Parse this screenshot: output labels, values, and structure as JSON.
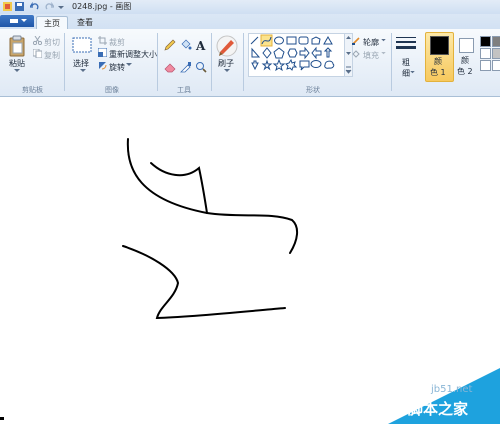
{
  "window": {
    "title": "0248.jpg - 画图"
  },
  "tabs": [
    {
      "label": "主页",
      "active": true
    },
    {
      "label": "查看",
      "active": false
    }
  ],
  "clipboard": {
    "paste_label": "粘贴",
    "cut_label": "剪切",
    "copy_label": "复制",
    "group_label": "剪贴板"
  },
  "image": {
    "select_label": "选择",
    "crop_label": "裁剪",
    "resize_label": "重新调整大小",
    "rotate_label": "旋转",
    "group_label": "图像"
  },
  "tools": {
    "group_label": "工具",
    "items": [
      "pencil-icon",
      "fill-icon",
      "text-icon",
      "eraser-icon",
      "color-picker-icon",
      "magnifier-icon"
    ]
  },
  "brushes": {
    "label": "刷子"
  },
  "shapes": {
    "group_label": "形状",
    "outline_label": "轮廓",
    "fill_label": "填充",
    "selected": "curve"
  },
  "colors": {
    "size_label": "粗",
    "size_label_2": "细",
    "color1_label": "颜",
    "color1_label_2": "色 1",
    "color2_label": "颜",
    "color2_label_2": "色 2",
    "color1_value": "#000000",
    "color2_value": "#ffffff"
  },
  "watermark": {
    "site": "jb51.net",
    "name": "脚本之家",
    "color": "#1ea2de"
  }
}
